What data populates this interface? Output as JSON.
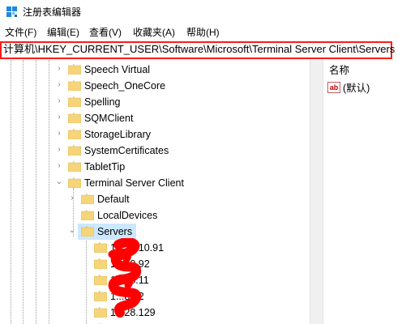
{
  "window": {
    "title": "注册表编辑器"
  },
  "menu": {
    "items": [
      {
        "label": "文件(F)"
      },
      {
        "label": "编辑(E)"
      },
      {
        "label": "查看(V)"
      },
      {
        "label": "收藏夹(A)"
      },
      {
        "label": "帮助(H)"
      }
    ]
  },
  "address": {
    "path": "计算机\\HKEY_CURRENT_USER\\Software\\Microsoft\\Terminal Server Client\\Servers"
  },
  "tree": {
    "nodes": [
      {
        "label": "Speech Virtual",
        "expanded": false
      },
      {
        "label": "Speech_OneCore",
        "expanded": false
      },
      {
        "label": "Spelling",
        "expanded": false
      },
      {
        "label": "SQMClient",
        "expanded": false
      },
      {
        "label": "StorageLibrary",
        "expanded": false
      },
      {
        "label": "SystemCertificates",
        "expanded": false
      },
      {
        "label": "TabletTip",
        "expanded": false
      },
      {
        "label": "Terminal Server Client",
        "expanded": true
      },
      {
        "label": "Default",
        "expanded": false
      },
      {
        "label": "LocalDevices",
        "expanded": false
      },
      {
        "label": "Servers",
        "expanded": true,
        "selected": true
      },
      {
        "label": "10.10.10.91"
      },
      {
        "label": "1...10.92"
      },
      {
        "label": "1...28.11"
      },
      {
        "label": "1...8.12"
      },
      {
        "label": "1...28.129"
      }
    ]
  },
  "values_pane": {
    "column_name": "名称",
    "rows": [
      {
        "icon": "ab",
        "name": "(默认)"
      }
    ]
  },
  "colors": {
    "address_highlight": "#ff1a1a",
    "selection": "#cce8ff",
    "folder": "#f6d57a",
    "redaction": "#ff0000"
  }
}
